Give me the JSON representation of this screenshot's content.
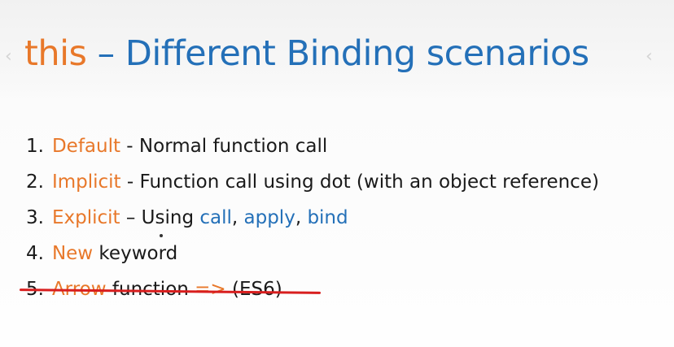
{
  "title": {
    "keyword": "this",
    "rest": " – Different Binding scenarios"
  },
  "nav": {
    "left_arrow": "‹",
    "right_arrow": "‹"
  },
  "items": [
    {
      "number": "1.",
      "key": "Default",
      "text": " - Normal function call"
    },
    {
      "number": "2.",
      "key": "Implicit",
      "text": " - Function call using dot (with an object reference)"
    },
    {
      "number": "3.",
      "key": "Explicit",
      "text_before": " – Using ",
      "call": "call",
      "sep1": ", ",
      "apply": "apply",
      "sep2": ", ",
      "bind": "bind"
    },
    {
      "number": "4.",
      "key": "New",
      "text": " keyword"
    },
    {
      "number": "5.",
      "key": "Arrow",
      "text_plain": " function ",
      "arrow": "=>",
      "text_end": " (ES6)",
      "struck": true
    }
  ],
  "colors": {
    "keyword_orange": "#e8782a",
    "title_blue": "#2470b8",
    "text": "#1a1a1a",
    "strike_red": "#d81e1e"
  }
}
